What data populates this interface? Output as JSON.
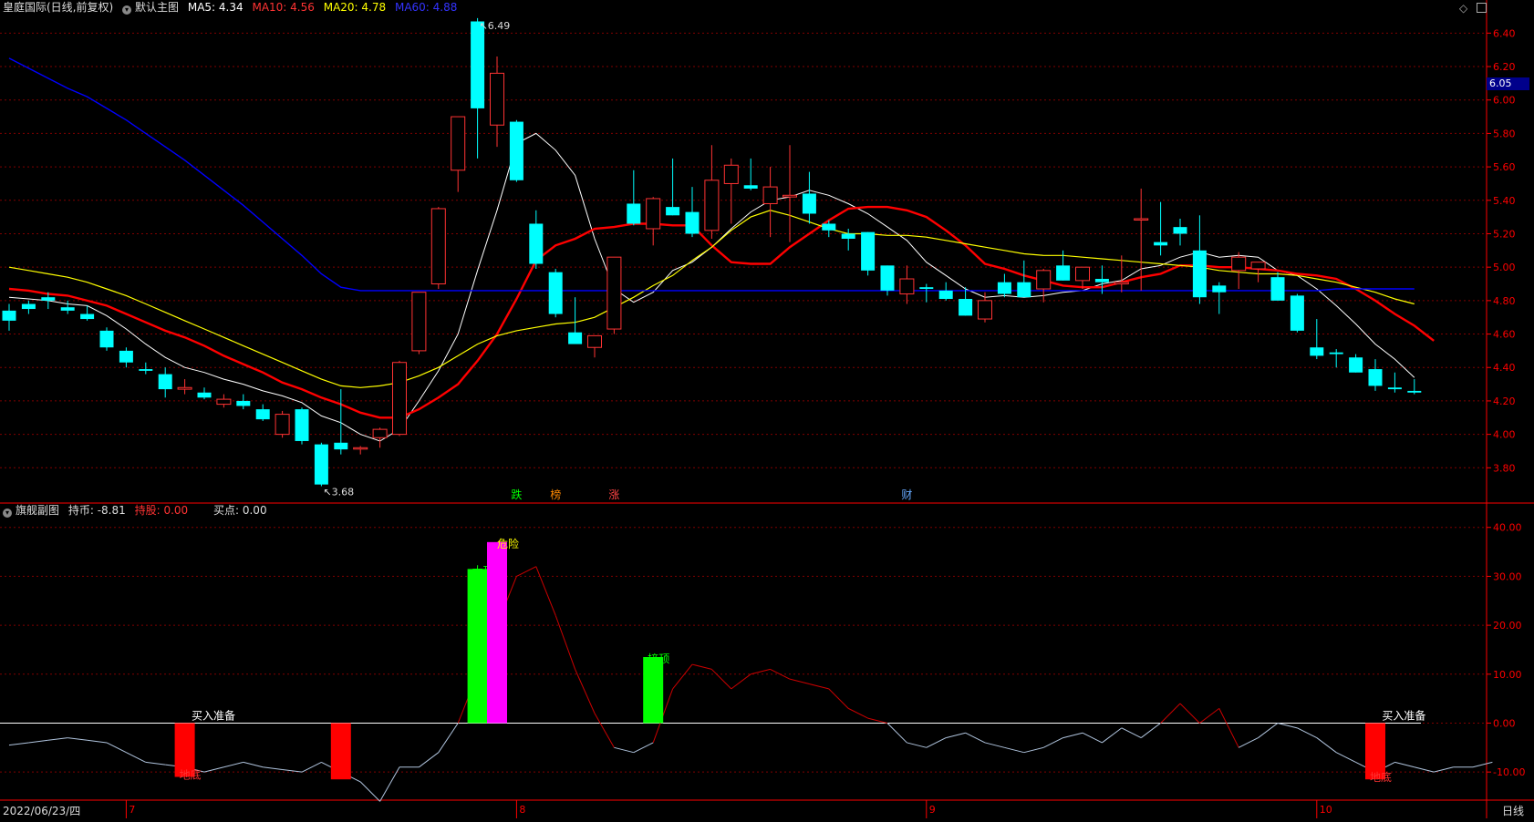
{
  "app": {
    "stock_name": "皇庭国际(日线,前复权)",
    "main_chart_label": "默认主图",
    "sub_chart_label": "旗舰副图",
    "period": "日线",
    "date_cursor": "2022/06/23/四"
  },
  "colors": {
    "ma5": "#ffffff",
    "ma10": "#ff0000",
    "ma20": "#ffff00",
    "ma60": "#0000ff",
    "up": "#ff3333",
    "down": "#00ffff",
    "grid": "#800000",
    "axis": "#ff0000",
    "indicator": "#cc0000",
    "indicator_low": "#b0c4de",
    "bar_red": "#ff0000",
    "bar_green": "#00ff00",
    "bar_magenta": "#ff00ff"
  },
  "main_header": {
    "ma5_label": "MA5: 4.34",
    "ma10_label": "MA10: 4.56",
    "ma20_label": "MA20: 4.78",
    "ma60_label": "MA60: 4.88"
  },
  "sub_header": {
    "hold_label": "持币: -8.81",
    "stock_label": "持股: 0.00",
    "buy_label": "买点: 0.00"
  },
  "price_marker": "6.05",
  "chart_data": [
    {
      "type": "candlestick",
      "ylim": [
        3.6,
        6.5
      ],
      "yticks": [
        "6.40",
        "6.20",
        "6.00",
        "5.80",
        "5.60",
        "5.40",
        "5.20",
        "5.00",
        "4.80",
        "4.60",
        "4.40",
        "4.20",
        "4.00",
        "3.80"
      ],
      "xticks": [
        "7",
        "8",
        "9",
        "10"
      ],
      "high_label": "6.49",
      "low_label": "3.68",
      "candles": [
        [
          4.74,
          4.78,
          4.62,
          4.68
        ],
        [
          4.78,
          4.8,
          4.72,
          4.75
        ],
        [
          4.82,
          4.85,
          4.75,
          4.8
        ],
        [
          4.76,
          4.8,
          4.72,
          4.74
        ],
        [
          4.72,
          4.77,
          4.68,
          4.69
        ],
        [
          4.62,
          4.64,
          4.5,
          4.52
        ],
        [
          4.5,
          4.52,
          4.4,
          4.43
        ],
        [
          4.39,
          4.43,
          4.36,
          4.38
        ],
        [
          4.36,
          4.4,
          4.22,
          4.27
        ],
        [
          4.27,
          4.33,
          4.24,
          4.28
        ],
        [
          4.25,
          4.28,
          4.21,
          4.22
        ],
        [
          4.18,
          4.24,
          4.16,
          4.21
        ],
        [
          4.2,
          4.24,
          4.15,
          4.17
        ],
        [
          4.15,
          4.18,
          4.08,
          4.09
        ],
        [
          4.0,
          4.14,
          3.98,
          4.12
        ],
        [
          4.15,
          4.16,
          3.94,
          3.96
        ],
        [
          3.94,
          3.95,
          3.69,
          3.7
        ],
        [
          3.95,
          4.27,
          3.88,
          3.91
        ],
        [
          3.92,
          3.93,
          3.88,
          3.92
        ],
        [
          3.98,
          4.04,
          3.92,
          4.03
        ],
        [
          4.0,
          4.44,
          3.99,
          4.43
        ],
        [
          4.5,
          4.84,
          4.48,
          4.85
        ],
        [
          4.9,
          5.36,
          4.87,
          5.35
        ],
        [
          5.58,
          5.89,
          5.45,
          5.9
        ],
        [
          6.47,
          6.49,
          5.65,
          5.95
        ],
        [
          5.85,
          6.26,
          5.72,
          6.16
        ],
        [
          5.87,
          5.88,
          5.51,
          5.52
        ],
        [
          5.26,
          5.34,
          4.99,
          5.02
        ],
        [
          4.97,
          4.99,
          4.7,
          4.72
        ],
        [
          4.61,
          4.82,
          4.55,
          4.54
        ],
        [
          4.52,
          4.58,
          4.46,
          4.59
        ],
        [
          4.63,
          5.05,
          4.6,
          5.06
        ],
        [
          5.38,
          5.58,
          5.25,
          5.26
        ],
        [
          5.23,
          5.42,
          5.13,
          5.41
        ],
        [
          5.36,
          5.65,
          5.31,
          5.31
        ],
        [
          5.33,
          5.48,
          5.18,
          5.2
        ],
        [
          5.22,
          5.73,
          5.17,
          5.52
        ],
        [
          5.5,
          5.65,
          5.26,
          5.61
        ],
        [
          5.49,
          5.65,
          5.46,
          5.47
        ],
        [
          5.38,
          5.6,
          5.18,
          5.48
        ],
        [
          5.42,
          5.73,
          5.15,
          5.43
        ],
        [
          5.44,
          5.57,
          5.26,
          5.32
        ],
        [
          5.26,
          5.28,
          5.18,
          5.22
        ],
        [
          5.2,
          5.23,
          5.1,
          5.17
        ],
        [
          5.21,
          5.21,
          4.95,
          4.98
        ],
        [
          5.01,
          5.01,
          4.83,
          4.86
        ],
        [
          4.84,
          5.01,
          4.78,
          4.93
        ],
        [
          4.88,
          4.9,
          4.79,
          4.87
        ],
        [
          4.86,
          4.91,
          4.8,
          4.81
        ],
        [
          4.81,
          4.88,
          4.71,
          4.71
        ],
        [
          4.69,
          4.85,
          4.67,
          4.8
        ],
        [
          4.91,
          4.96,
          4.82,
          4.84
        ],
        [
          4.91,
          5.04,
          4.83,
          4.82
        ],
        [
          4.87,
          4.99,
          4.79,
          4.98
        ],
        [
          5.01,
          5.1,
          4.92,
          4.92
        ],
        [
          4.92,
          4.95,
          4.87,
          5.0
        ],
        [
          4.93,
          5.01,
          4.84,
          4.91
        ],
        [
          4.9,
          5.07,
          4.85,
          4.91
        ],
        [
          5.29,
          5.47,
          4.86,
          5.29
        ],
        [
          5.15,
          5.39,
          5.07,
          5.13
        ],
        [
          5.24,
          5.29,
          5.13,
          5.2
        ],
        [
          5.1,
          5.31,
          4.78,
          4.82
        ],
        [
          4.89,
          4.91,
          4.72,
          4.85
        ],
        [
          4.98,
          5.09,
          4.87,
          5.06
        ],
        [
          4.99,
          5.02,
          4.91,
          5.03
        ],
        [
          4.94,
          4.97,
          4.81,
          4.8
        ],
        [
          4.83,
          4.84,
          4.61,
          4.62
        ],
        [
          4.52,
          4.69,
          4.45,
          4.47
        ],
        [
          4.49,
          4.51,
          4.4,
          4.48
        ],
        [
          4.46,
          4.48,
          4.37,
          4.37
        ],
        [
          4.39,
          4.45,
          4.26,
          4.29
        ],
        [
          4.28,
          4.37,
          4.25,
          4.27
        ],
        [
          4.26,
          4.33,
          4.24,
          4.25
        ]
      ],
      "series": [
        {
          "name": "MA5",
          "values": [
            4.82,
            4.81,
            4.8,
            4.78,
            4.77,
            4.71,
            4.63,
            4.54,
            4.46,
            4.4,
            4.37,
            4.33,
            4.3,
            4.26,
            4.23,
            4.19,
            4.11,
            4.07,
            4.0,
            3.96,
            4.03,
            4.2,
            4.38,
            4.6,
            4.98,
            5.34,
            5.74,
            5.8,
            5.7,
            5.55,
            5.17,
            4.87,
            4.79,
            4.85,
            4.98,
            5.03,
            5.12,
            5.23,
            5.33,
            5.4,
            5.42,
            5.46,
            5.43,
            5.38,
            5.32,
            5.24,
            5.16,
            5.03,
            4.95,
            4.87,
            4.82,
            4.83,
            4.82,
            4.83,
            4.85,
            4.86,
            4.9,
            4.92,
            4.99,
            5.01,
            5.06,
            5.09,
            5.06,
            5.07,
            5.06,
            4.98,
            4.95,
            4.87,
            4.77,
            4.66,
            4.54,
            4.45,
            4.34
          ]
        },
        {
          "name": "MA10",
          "values": [
            4.87,
            4.86,
            4.84,
            4.83,
            4.8,
            4.77,
            4.72,
            4.67,
            4.62,
            4.58,
            4.53,
            4.47,
            4.42,
            4.37,
            4.31,
            4.27,
            4.22,
            4.18,
            4.13,
            4.1,
            4.1,
            4.15,
            4.22,
            4.3,
            4.44,
            4.6,
            4.81,
            5.04,
            5.13,
            5.17,
            5.23,
            5.24,
            5.26,
            5.26,
            5.25,
            5.25,
            5.13,
            5.03,
            5.02,
            5.02,
            5.12,
            5.2,
            5.28,
            5.35,
            5.36,
            5.36,
            5.34,
            5.3,
            5.22,
            5.13,
            5.02,
            4.99,
            4.95,
            4.92,
            4.89,
            4.88,
            4.88,
            4.91,
            4.94,
            4.96,
            5.01,
            5.01,
            5.0,
            5.0,
            4.99,
            4.98,
            4.96,
            4.95,
            4.93,
            4.87,
            4.8,
            4.72,
            4.65,
            4.56
          ]
        },
        {
          "name": "MA20",
          "values": [
            5.0,
            4.98,
            4.96,
            4.94,
            4.91,
            4.87,
            4.83,
            4.78,
            4.73,
            4.68,
            4.63,
            4.58,
            4.53,
            4.48,
            4.43,
            4.38,
            4.33,
            4.29,
            4.28,
            4.29,
            4.31,
            4.35,
            4.4,
            4.47,
            4.54,
            4.59,
            4.62,
            4.64,
            4.66,
            4.67,
            4.7,
            4.76,
            4.82,
            4.89,
            4.95,
            5.04,
            5.12,
            5.22,
            5.3,
            5.34,
            5.31,
            5.27,
            5.23,
            5.2,
            5.2,
            5.19,
            5.19,
            5.18,
            5.16,
            5.14,
            5.12,
            5.1,
            5.08,
            5.07,
            5.07,
            5.06,
            5.05,
            5.04,
            5.03,
            5.02,
            5.01,
            5.0,
            4.98,
            4.97,
            4.96,
            4.96,
            4.95,
            4.93,
            4.91,
            4.88,
            4.85,
            4.81,
            4.78
          ]
        },
        {
          "name": "MA60",
          "values": [
            6.25,
            6.19,
            6.13,
            6.07,
            6.02,
            5.95,
            5.88,
            5.8,
            5.72,
            5.64,
            5.55,
            5.46,
            5.37,
            5.27,
            5.17,
            5.07,
            4.96,
            4.88,
            4.86,
            4.86,
            4.86,
            4.86,
            4.86,
            4.86,
            4.86,
            4.86,
            4.86,
            4.86,
            4.86,
            4.86,
            4.86,
            4.86,
            4.86,
            4.86,
            4.86,
            4.86,
            4.86,
            4.86,
            4.86,
            4.86,
            4.86,
            4.86,
            4.86,
            4.86,
            4.86,
            4.86,
            4.86,
            4.86,
            4.86,
            4.86,
            4.86,
            4.86,
            4.86,
            4.86,
            4.86,
            4.86,
            4.86,
            4.86,
            4.86,
            4.86,
            4.86,
            4.86,
            4.86,
            4.86,
            4.86,
            4.86,
            4.86,
            4.86,
            4.87,
            4.87,
            4.87,
            4.87,
            4.87
          ]
        }
      ],
      "event_markers": [
        {
          "label": "跌",
          "index": 26,
          "color": "#00ff00"
        },
        {
          "label": "榜",
          "index": 28,
          "color": "#ff8800"
        },
        {
          "label": "涨",
          "index": 31,
          "color": "#ff4444"
        },
        {
          "label": "财",
          "index": 46,
          "color": "#66aaff"
        }
      ]
    },
    {
      "type": "indicator",
      "ylim": [
        -15,
        42
      ],
      "yticks": [
        "40.00",
        "30.00",
        "20.00",
        "10.00",
        "0.00",
        "-10.00"
      ],
      "line": [
        -4.5,
        -4,
        -3.5,
        -3,
        -3.5,
        -4,
        -6,
        -8,
        -8.5,
        -9,
        -10,
        -9,
        -8,
        -9,
        -9.5,
        -10,
        -8,
        -10,
        -12,
        -16,
        -9,
        -9,
        -6,
        0,
        10,
        20,
        30,
        32,
        22,
        11,
        2,
        -5,
        -6,
        -4,
        7,
        12,
        11,
        7,
        10,
        11,
        9,
        8,
        7,
        3,
        1,
        0,
        -4,
        -5,
        -3,
        -2,
        -4,
        -5,
        -6,
        -5,
        -3,
        -2,
        -4,
        -1,
        -3,
        0,
        4,
        0,
        3,
        -5,
        -3,
        0,
        -1,
        -3,
        -6,
        -8,
        -10,
        -8,
        -9,
        -10,
        -9,
        -9,
        -8
      ],
      "bars": [
        {
          "index": 9,
          "value": -11,
          "color": "#ff0000",
          "label": "地底"
        },
        {
          "index": 17,
          "value": -11.5,
          "color": "#ff0000",
          "label": ""
        },
        {
          "index": 24,
          "value": 31.5,
          "color": "#00ff00",
          "label": "大顶"
        },
        {
          "index": 25,
          "value": 37,
          "color": "#ff00ff",
          "label": "危险"
        },
        {
          "index": 33,
          "value": 13.5,
          "color": "#00ff00",
          "label": "接顶"
        },
        {
          "index": 70,
          "value": -11.5,
          "color": "#ff0000",
          "label": "地底"
        }
      ],
      "annotations": [
        {
          "text": "买入准备",
          "index": 10
        },
        {
          "text": "买入准备",
          "index": 71
        }
      ]
    }
  ]
}
